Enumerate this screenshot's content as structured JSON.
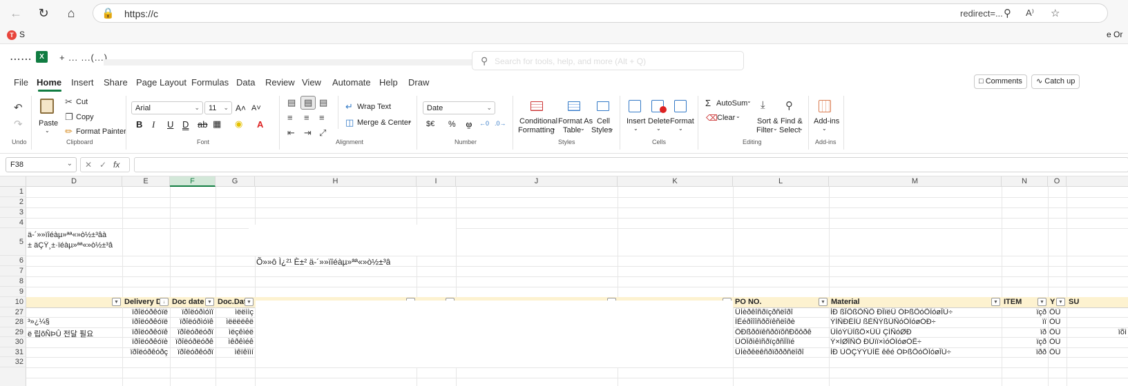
{
  "browser": {
    "url": "https://c",
    "url_right": "redirect=...",
    "bookmark_first": "S",
    "bookmark_last": "e Or"
  },
  "excel": {
    "filename": "+ ... ...(...) ...",
    "search_placeholder": "Search for tools, help, and more (Alt + Q)"
  },
  "menu": {
    "tabs": [
      "File",
      "Home",
      "Insert",
      "Share",
      "Page Layout",
      "Formulas",
      "Data",
      "Review",
      "View",
      "Automate",
      "Help",
      "Draw"
    ],
    "active": "Home",
    "comments": "Comments",
    "catchup": "Catch up"
  },
  "ribbon": {
    "undo_group": "Undo",
    "clipboard_group": "Clipboard",
    "paste": "Paste",
    "cut": "Cut",
    "copy": "Copy",
    "format_painter": "Format Painter",
    "font_group": "Font",
    "font_name": "Arial",
    "font_size": "11",
    "alignment_group": "Alignment",
    "wrap_text": "Wrap Text",
    "merge_center": "Merge & Center",
    "number_group": "Number",
    "number_format": "Date",
    "styles_group": "Styles",
    "conditional_formatting": [
      "Conditional",
      "Formatting"
    ],
    "format_as_table": [
      "Format As",
      "Table"
    ],
    "cell_styles": [
      "Cell",
      "Styles"
    ],
    "cells_group": "Cells",
    "insert": "Insert",
    "delete": "Delete",
    "format": "Format",
    "editing_group": "Editing",
    "autosum": "AutoSum",
    "clear": "Clear",
    "sort_filter": [
      "Sort &",
      "Filter"
    ],
    "find_select": [
      "Find &",
      "Select"
    ],
    "addins_group": "Add-ins",
    "addins": "Add-ins"
  },
  "formula_bar": {
    "name_box": "F38",
    "fx": "fx"
  },
  "grid": {
    "columns": [
      "D",
      "E",
      "F",
      "G",
      "H",
      "I",
      "J",
      "K",
      "L",
      "M",
      "N",
      "O"
    ],
    "selected_column": "F",
    "rows": [
      "1",
      "2",
      "3",
      "4",
      "5",
      "6",
      "7",
      "8",
      "9",
      "10",
      "27",
      "28",
      "29",
      "30",
      "31",
      "32"
    ],
    "d5_line1": "ä-´»»ïîéàµ»ªª«»ò½±³âà",
    "d5_line2": "± äÇŸ¸±·ïéàµ»ªª«»ò½±³â",
    "h6": "Õ»»ô Ì¿²¹ È±² ä-´»»ïîéàµ»ªª«»ò½±³â",
    "headers": {
      "D": "",
      "E": "Delivery D",
      "F": "Doc date",
      "G": "Doc.Dat",
      "H": "",
      "I": "",
      "J": "",
      "K": "",
      "L": "PO NO.",
      "M": "Material",
      "N": "ITEM",
      "O": "Y",
      "P": "SU"
    },
    "data_rows": [
      {
        "row": "27",
        "D": "",
        "E": "ïðîëóðêóïë",
        "F": "ïðîëóðìóïï",
        "G": "ìëëììç",
        "L": "ÛÌèðêîñðïçðñëîðî",
        "M": "ÌÐ ßÎÕßÕÑÕ ÐÎïëÛ ÓÞßÕóÕÏóøÎÙ÷",
        "N": "ïçð",
        "O": "ÔÙ"
      },
      {
        "row": "28",
        "D": "³»¿¼§",
        "E": "ïðîëóðêóïë",
        "F": "ïðîëóðìóïê",
        "G": "ìëëëëêë",
        "L": "ÌÈéðîîîñðõïêñëîðè",
        "M": "ÝÌÑÐÉÌÜ ßÈÑÝßÜÑóÕÏóøÓÐ÷",
        "N": "ïï",
        "O": "ÔÙ"
      },
      {
        "row": "29",
        "D": "ë 립õÑÞÛ 전달 필요",
        "E": "ïðîëóðêóïê",
        "F": "ïðîëóðëóðï",
        "G": "ìëçêìéë",
        "L": "ÔÐßðôïêñðôïõñÐõôðê",
        "M": "ÛÌóÝÛÌßÔ×ÛÜ ÇÍÑóØÐ",
        "N": "ïð",
        "O": "ÔÙ",
        "P": "ïõì"
      },
      {
        "row": "30",
        "D": "",
        "E": "ïðîëóðêóïè",
        "F": "ïðîëóðëóðê",
        "G": "ìêðêìéê",
        "L": "ÛÔÎðìêïñðïçðñÎÏïé",
        "M": "Ý×ÌØÎÑÕ ÐÛïï×ìóÕÏóøÔÊ÷",
        "N": "ïçð",
        "O": "ÔÙ"
      },
      {
        "row": "31",
        "D": "",
        "E": "ïðîëóðêóðç",
        "F": "ïðîëóðêóðï",
        "G": "ìêïêììí",
        "L": "ÛÌèðêëêñðïðððñëîðî",
        "M": "ÌÐ ÙÔÇÝÝÙÍË êêé ÓÞßÕóÕÏóøÎÙ÷",
        "N": "ïðð",
        "O": "ÔÙ"
      }
    ]
  }
}
